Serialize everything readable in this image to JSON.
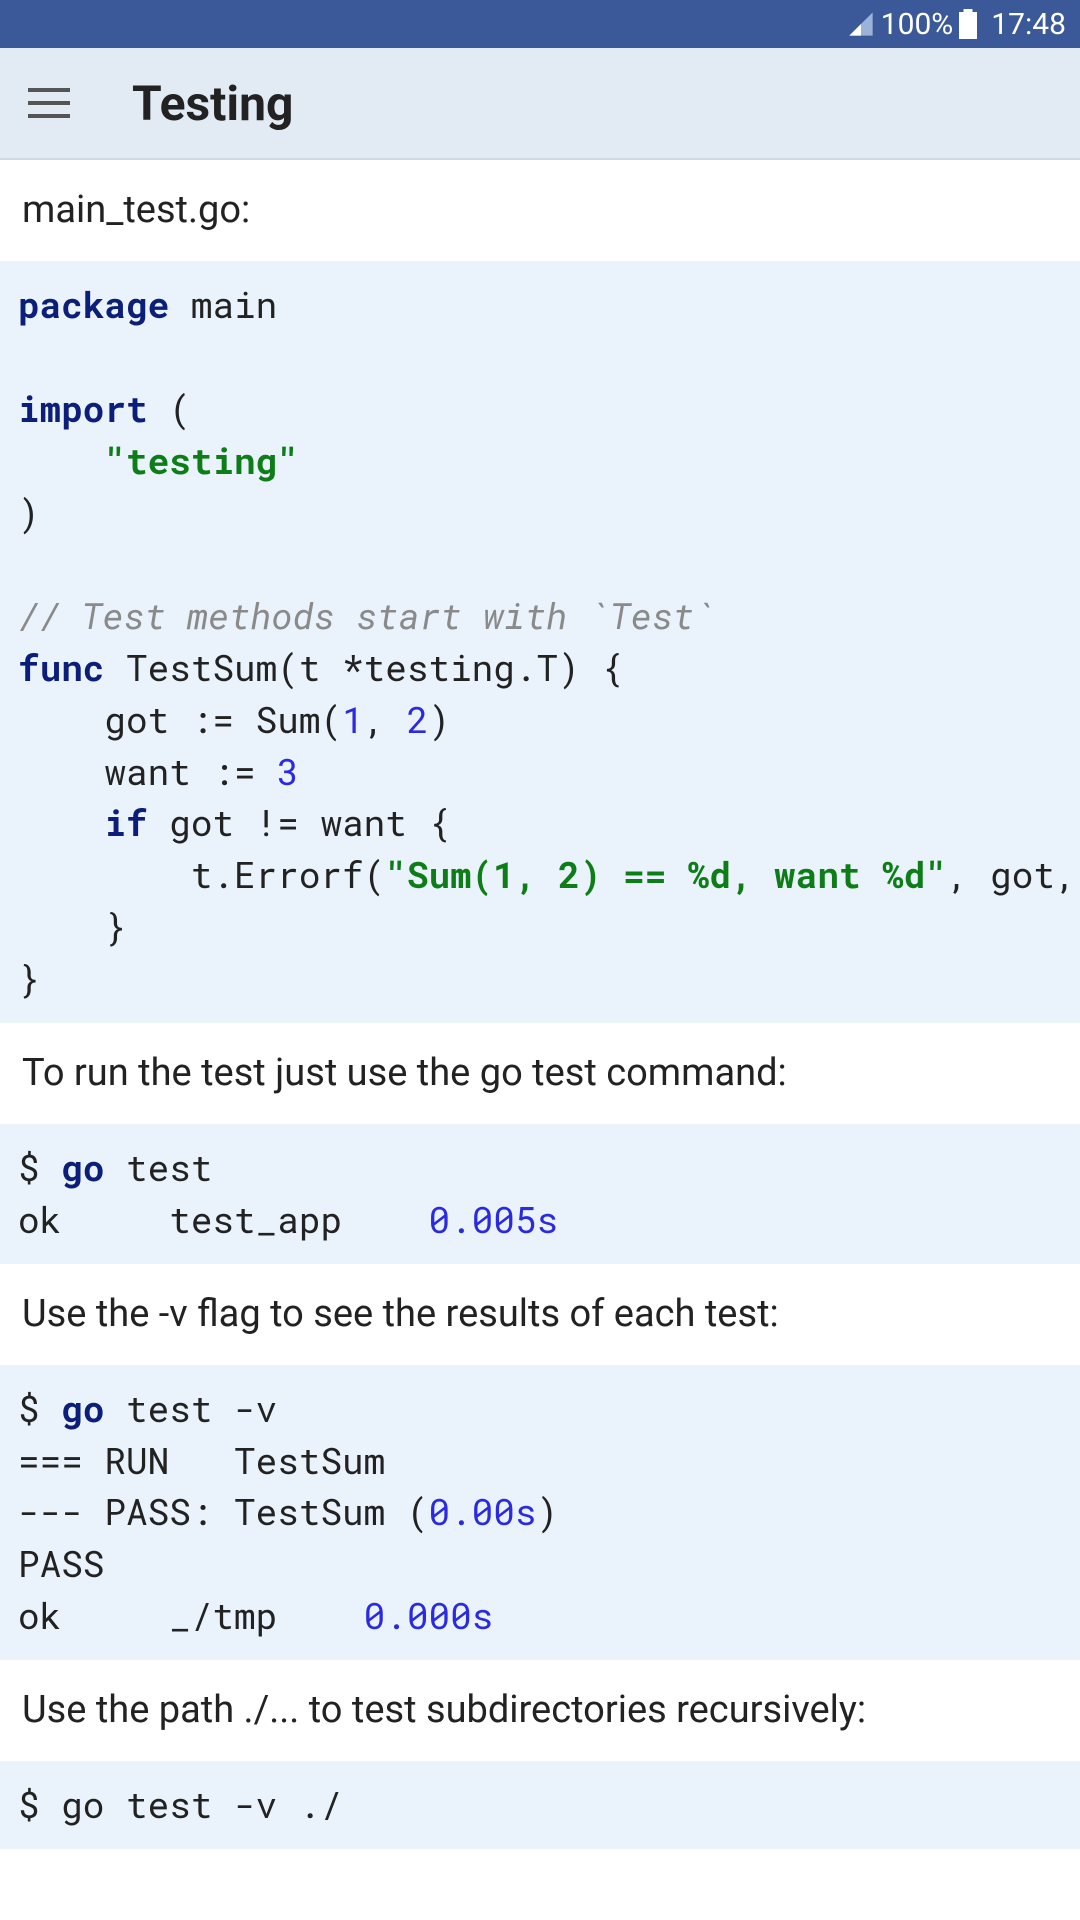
{
  "status": {
    "battery_pct": "100%",
    "time": "17:48"
  },
  "appbar": {
    "title": "Testing"
  },
  "content": {
    "file_label": "main_test.go:",
    "code1": {
      "l1_kw": "package",
      "l1_rest": " main",
      "l2": "",
      "l3_kw": "import",
      "l3_rest": " (",
      "l4_indent": "    ",
      "l4_str": "\"testing\"",
      "l5": ")",
      "l6": "",
      "l7_com": "// Test methods start with `Test`",
      "l8_kw": "func",
      "l8_rest": " TestSum(t *testing.T) {",
      "l9a": "    got := Sum(",
      "l9n1": "1",
      "l9b": ", ",
      "l9n2": "2",
      "l9c": ")",
      "l10a": "    want := ",
      "l10n": "3",
      "l11_indent": "    ",
      "l11_kw": "if",
      "l11_rest": " got != want {",
      "l12a": "        t.Errorf(",
      "l12_str": "\"Sum(1, 2) == %d, want %d\"",
      "l12b": ", got, want)",
      "l13": "    }",
      "l14": "}"
    },
    "para1": "To run the test just use the go test command:",
    "code2": {
      "l1a": "$ ",
      "l1_kw": "go",
      "l1b": " test",
      "l2a": "ok     test_app    ",
      "l2_num": "0.005s"
    },
    "para2": "Use the -v flag to see the results of each test:",
    "code3": {
      "l1a": "$ ",
      "l1_kw": "go",
      "l1b": " test -v",
      "l2": "=== RUN   TestSum",
      "l3a": "--- PASS: TestSum (",
      "l3_num": "0.00s",
      "l3b": ")",
      "l4": "PASS",
      "l5a": "ok     _/tmp    ",
      "l5_num": "0.000s"
    },
    "para3": "Use the path ./... to test subdirectories recursively:",
    "code4_partial": "$ go test -v ./"
  }
}
